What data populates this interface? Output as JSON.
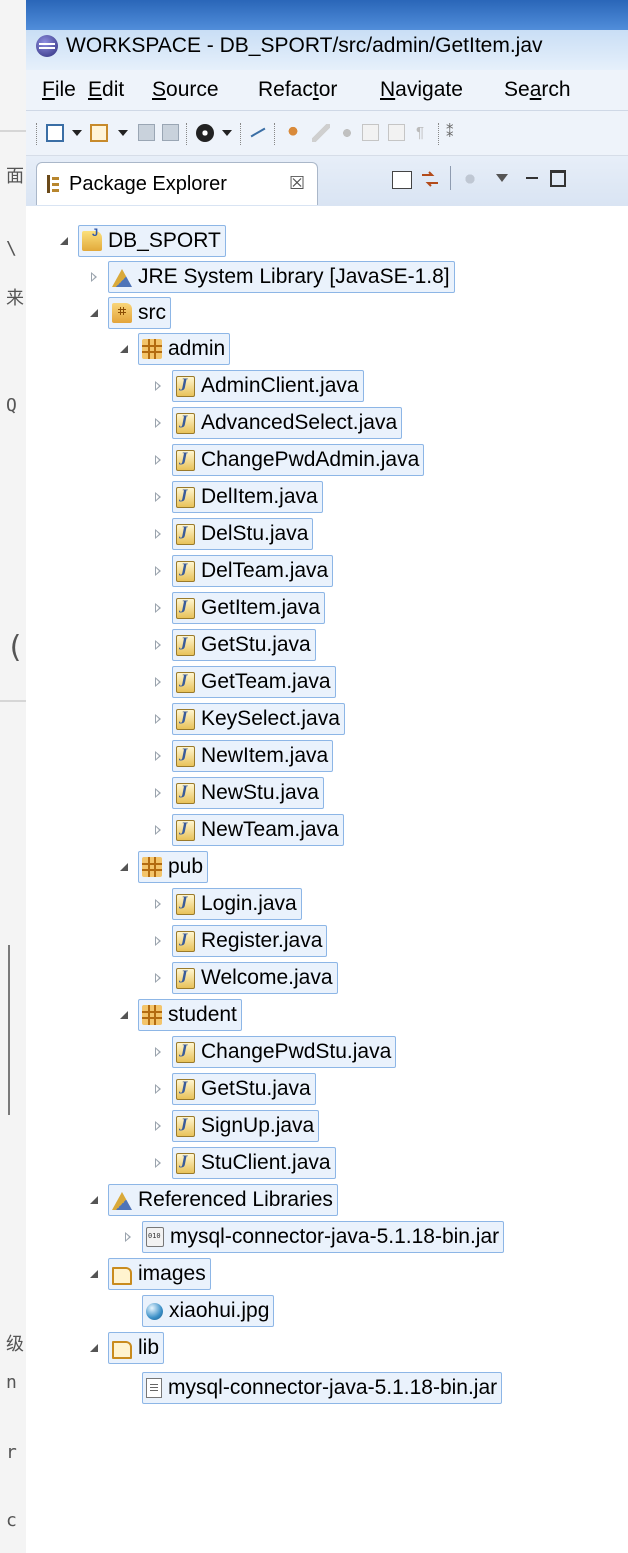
{
  "window": {
    "title": "WORKSPACE - DB_SPORT/src/admin/GetItem.jav"
  },
  "menubar": {
    "items": [
      {
        "pre": "",
        "key": "F",
        "post": "ile"
      },
      {
        "pre": "",
        "key": "E",
        "post": "dit"
      },
      {
        "pre": "",
        "key": "S",
        "post": "ource"
      },
      {
        "pre": "Refac",
        "key": "t",
        "post": "or"
      },
      {
        "pre": "",
        "key": "N",
        "post": "avigate"
      },
      {
        "pre": "Se",
        "key": "a",
        "post": "rch"
      }
    ]
  },
  "view": {
    "tab_label": "Package Explorer",
    "close_glyph": "☒"
  },
  "background_fragments": [
    "面",
    "\\",
    "来",
    "Q",
    "(",
    "级",
    "n",
    "r",
    "c"
  ],
  "tree": {
    "project": "DB_SPORT",
    "jre": "JRE System Library [JavaSE-1.8]",
    "src": "src",
    "packages": [
      {
        "name": "admin",
        "files": [
          "AdminClient.java",
          "AdvancedSelect.java",
          "ChangePwdAdmin.java",
          "DelItem.java",
          "DelStu.java",
          "DelTeam.java",
          "GetItem.java",
          "GetStu.java",
          "GetTeam.java",
          "KeySelect.java",
          "NewItem.java",
          "NewStu.java",
          "NewTeam.java"
        ]
      },
      {
        "name": "pub",
        "files": [
          "Login.java",
          "Register.java",
          "Welcome.java"
        ]
      },
      {
        "name": "student",
        "files": [
          "ChangePwdStu.java",
          "GetStu.java",
          "SignUp.java",
          "StuClient.java"
        ]
      }
    ],
    "referenced_libraries": "Referenced Libraries",
    "referenced_jar": "mysql-connector-java-5.1.18-bin.jar",
    "images_folder": "images",
    "image_file": "xiaohui.jpg",
    "lib_folder": "lib",
    "lib_file": "mysql-connector-java-5.1.18-bin.jar"
  }
}
